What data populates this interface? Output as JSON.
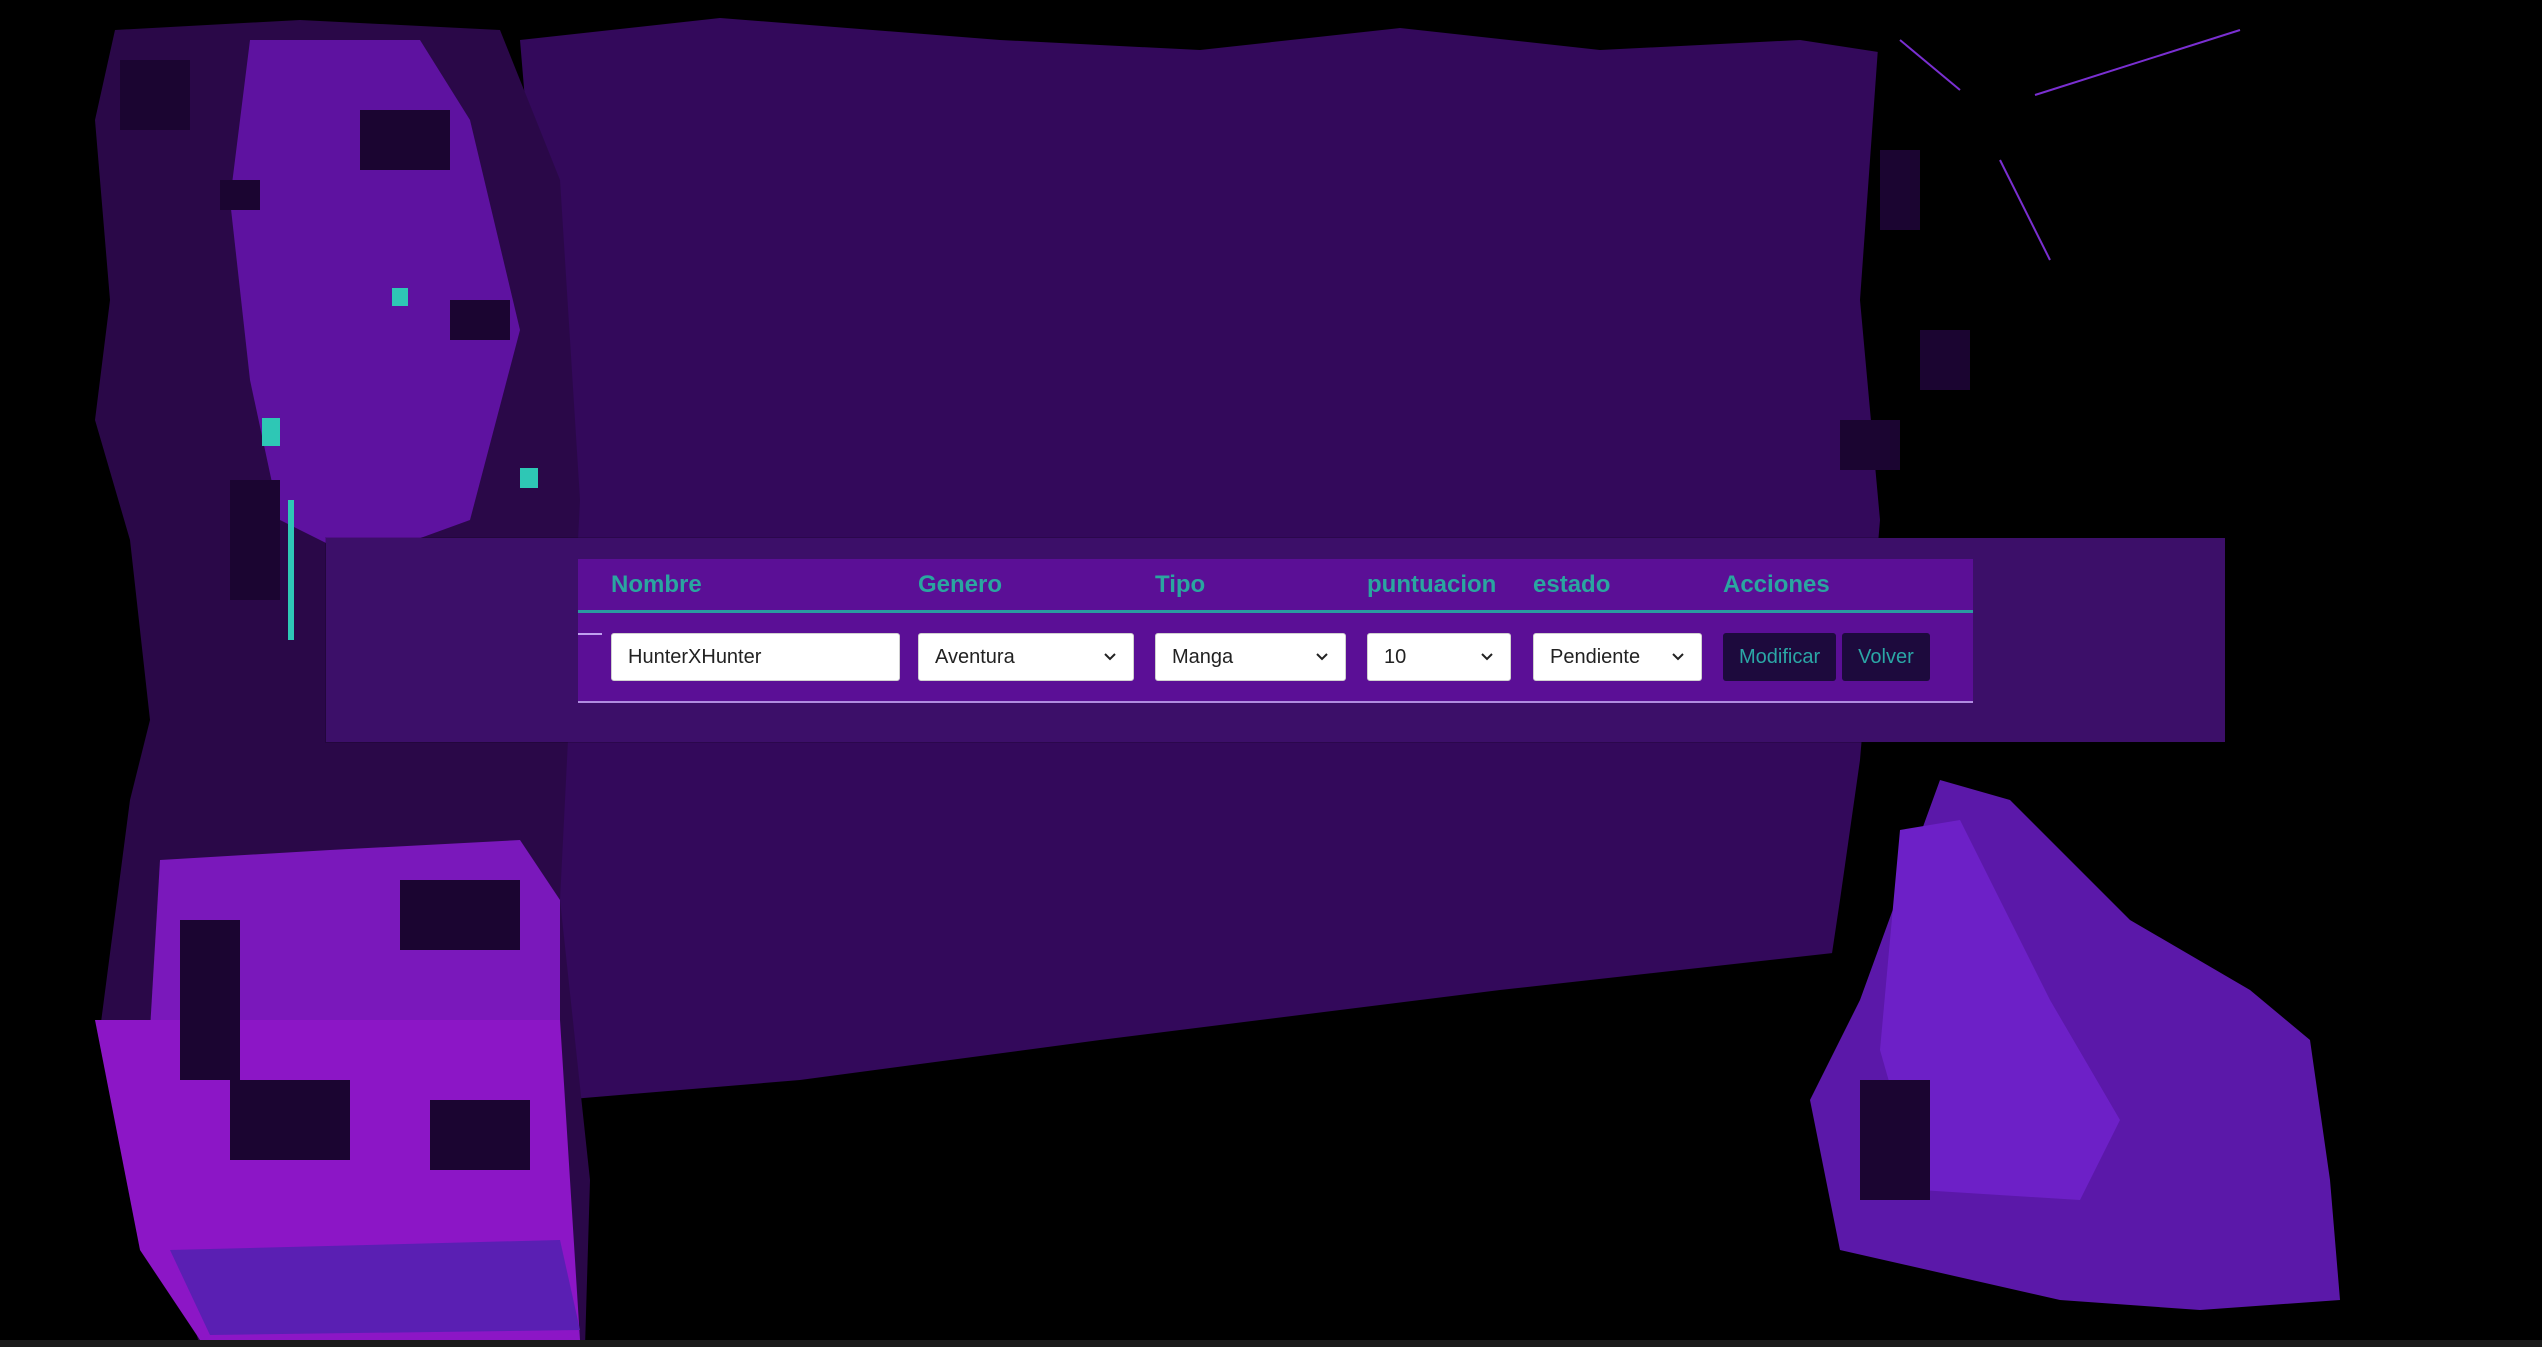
{
  "colors": {
    "page_background": "#000000",
    "panel": "#3c0f69",
    "table_background": "#5b0f96",
    "header_text": "#2aa6a0",
    "button_background": "#1d0a3d",
    "button_text": "#2ba7a6"
  },
  "table": {
    "headers": [
      "Nombre",
      "Genero",
      "Tipo",
      "puntuacion",
      "estado",
      "Acciones"
    ],
    "row": {
      "nombre_value": "HunterXHunter",
      "genero_selected": "Aventura",
      "tipo_selected": "Manga",
      "puntuacion_selected": "10",
      "estado_selected": "Pendiente"
    },
    "actions": {
      "modify_label": "Modificar",
      "back_label": "Volver"
    }
  },
  "icons": {
    "select_arrow": "chevron-down-icon"
  }
}
